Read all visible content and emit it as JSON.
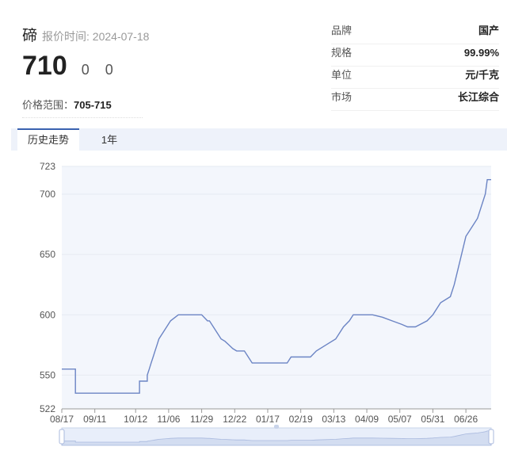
{
  "header": {
    "name": "碲",
    "date_label": "报价时间: 2024-07-18",
    "price": "710",
    "change": "0",
    "change_pct": "0",
    "range_label": "价格范围：",
    "range_value": "705-715"
  },
  "specs": [
    {
      "label": "品牌",
      "value": "国产"
    },
    {
      "label": "规格",
      "value": "99.99%"
    },
    {
      "label": "单位",
      "value": "元/千克"
    },
    {
      "label": "市场",
      "value": "长江综合"
    }
  ],
  "tabs": [
    {
      "label": "历史走势",
      "active": true
    },
    {
      "label": "1年",
      "active": false
    }
  ],
  "colors": {
    "line": "#6b84c4",
    "fill": "#f3f6fc",
    "grid": "#e6eaf2",
    "accent": "#3a62b0"
  },
  "chart_data": {
    "type": "line",
    "ylim": [
      522,
      723
    ],
    "yticks": [
      522,
      550,
      600,
      650,
      700,
      723
    ],
    "xticks": [
      "08/17",
      "09/11",
      "10/12",
      "11/06",
      "11/29",
      "12/22",
      "01/17",
      "02/19",
      "03/13",
      "04/09",
      "05/07",
      "05/31",
      "06/26"
    ],
    "x_index_range": [
      0,
      221
    ],
    "tick_indices": [
      0,
      17,
      38,
      55,
      72,
      89,
      106,
      123,
      140,
      157,
      174,
      191,
      208
    ],
    "x": [
      0,
      7,
      7,
      18,
      30,
      38,
      40,
      40,
      44,
      44,
      45,
      46,
      47,
      48,
      49,
      50,
      52,
      54,
      56,
      60,
      65,
      70,
      72,
      75,
      76,
      78,
      80,
      82,
      84,
      86,
      88,
      90,
      91,
      92,
      93,
      94,
      96,
      98,
      101,
      103,
      108,
      110,
      112,
      114,
      116,
      118,
      120,
      122,
      124,
      126,
      128,
      131,
      136,
      141,
      143,
      145,
      148,
      150,
      152,
      154,
      156,
      160,
      165,
      170,
      175,
      178,
      182,
      188,
      191,
      193,
      195,
      200,
      202,
      205,
      208,
      210,
      212,
      214,
      216,
      218,
      219,
      221
    ],
    "y": [
      555,
      555,
      535,
      535,
      535,
      535,
      535,
      545,
      545,
      550,
      555,
      560,
      565,
      570,
      575,
      580,
      585,
      590,
      595,
      600,
      600,
      600,
      600,
      595,
      595,
      590,
      585,
      580,
      578,
      575,
      572,
      570,
      570,
      570,
      570,
      570,
      565,
      560,
      560,
      560,
      560,
      560,
      560,
      560,
      560,
      565,
      565,
      565,
      565,
      565,
      565,
      570,
      575,
      580,
      585,
      590,
      595,
      600,
      600,
      600,
      600,
      600,
      598,
      595,
      592,
      590,
      590,
      595,
      600,
      605,
      610,
      615,
      625,
      645,
      665,
      670,
      675,
      680,
      690,
      700,
      712,
      712
    ]
  }
}
